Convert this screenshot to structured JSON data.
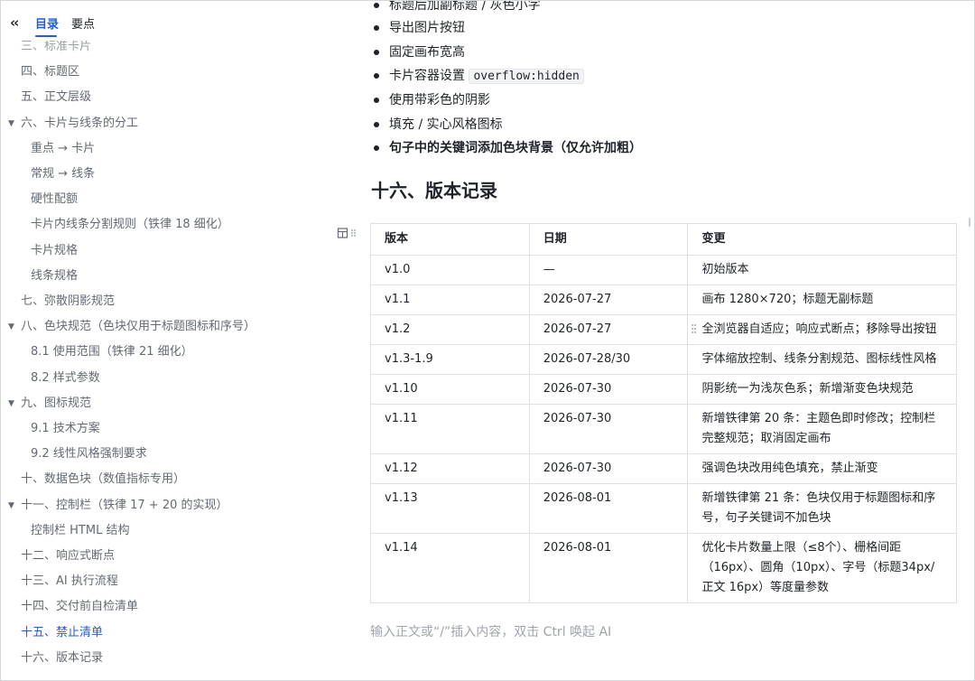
{
  "sidebar": {
    "tabs": [
      {
        "label": "目录"
      },
      {
        "label": "要点"
      }
    ],
    "items": [
      {
        "label": "三、标准卡片",
        "level": 1
      },
      {
        "label": "四、标题区",
        "level": 1
      },
      {
        "label": "五、正文层级",
        "level": 1
      },
      {
        "label": "六、卡片与线条的分工",
        "level": 1,
        "expanded": true
      },
      {
        "label": "重点 → 卡片",
        "level": 2
      },
      {
        "label": "常规 → 线条",
        "level": 2
      },
      {
        "label": "硬性配额",
        "level": 2
      },
      {
        "label": "卡片内线条分割规则（铁律 18 细化）",
        "level": 2
      },
      {
        "label": "卡片规格",
        "level": 2
      },
      {
        "label": "线条规格",
        "level": 2
      },
      {
        "label": "七、弥散阴影规范",
        "level": 1
      },
      {
        "label": "八、色块规范（色块仅用于标题图标和序号）",
        "level": 1,
        "expanded": true
      },
      {
        "label": "8.1 使用范围（铁律 21 细化）",
        "level": 2
      },
      {
        "label": "8.2 样式参数",
        "level": 2
      },
      {
        "label": "九、图标规范",
        "level": 1,
        "expanded": true
      },
      {
        "label": "9.1 技术方案",
        "level": 2
      },
      {
        "label": "9.2 线性风格强制要求",
        "level": 2
      },
      {
        "label": "十、数据色块（数值指标专用）",
        "level": 1
      },
      {
        "label": "十一、控制栏（铁律 17 + 20 的实现）",
        "level": 1,
        "expanded": true
      },
      {
        "label": "控制栏 HTML 结构",
        "level": 2
      },
      {
        "label": "十二、响应式断点",
        "level": 1
      },
      {
        "label": "十三、AI 执行流程",
        "level": 1
      },
      {
        "label": "十四、交付前自检清单",
        "level": 1
      },
      {
        "label": "十五、禁止清单",
        "level": 1,
        "active": true
      },
      {
        "label": "十六、版本记录",
        "level": 1
      }
    ]
  },
  "main": {
    "bullets": [
      {
        "text": "标题后加副标题 / 灰色小字"
      },
      {
        "text": "导出图片按钮"
      },
      {
        "text": "固定画布宽高"
      },
      {
        "text": "卡片容器设置",
        "code": "overflow:hidden"
      },
      {
        "text": "使用带彩色的阴影"
      },
      {
        "text": "填充 / 实心风格图标"
      },
      {
        "text": "句子中的关键词添加色块背景（仅允许加粗）",
        "bold": true
      }
    ],
    "section_title": "十六、版本记录",
    "table": {
      "headers": [
        "版本",
        "日期",
        "变更"
      ],
      "rows": [
        [
          "v1.0",
          "—",
          "初始版本"
        ],
        [
          "v1.1",
          "2026-07-27",
          "画布 1280×720；标题无副标题"
        ],
        [
          "v1.2",
          "2026-07-27",
          "全浏览器自适应；响应式断点；移除导出按钮"
        ],
        [
          "v1.3-1.9",
          "2026-07-28/30",
          "字体缩放控制、线条分割规范、图标线性风格"
        ],
        [
          "v1.10",
          "2026-07-30",
          "阴影统一为浅灰色系；新增渐变色块规范"
        ],
        [
          "v1.11",
          "2026-07-30",
          "新增铁律第 20 条：主题色即时修改；控制栏完整规范；取消固定画布"
        ],
        [
          "v1.12",
          "2026-07-30",
          "强调色块改用纯色填充，禁止渐变"
        ],
        [
          "v1.13",
          "2026-08-01",
          "新增铁律第 21 条：色块仅用于标题图标和序号，句子关键词不加色块"
        ],
        [
          "v1.14",
          "2026-08-01",
          "优化卡片数量上限（≤8个）、栅格间距（16px）、圆角（10px）、字号（标题34px/ 正文 16px）等度量参数"
        ]
      ]
    },
    "placeholder": "输入正文或“/”插入内容，双击 Ctrl 唤起 AI"
  },
  "colors": {
    "accent": "#245bdb",
    "text": "#1f2329",
    "muted": "#646a73",
    "border": "#dee0e3"
  },
  "icons": {
    "collapse": "double-chevron-left-icon",
    "table_handle": "table-grid-icon",
    "drag_handle": "drag-dots-icon",
    "expand_arrow": "triangle-down-icon"
  }
}
